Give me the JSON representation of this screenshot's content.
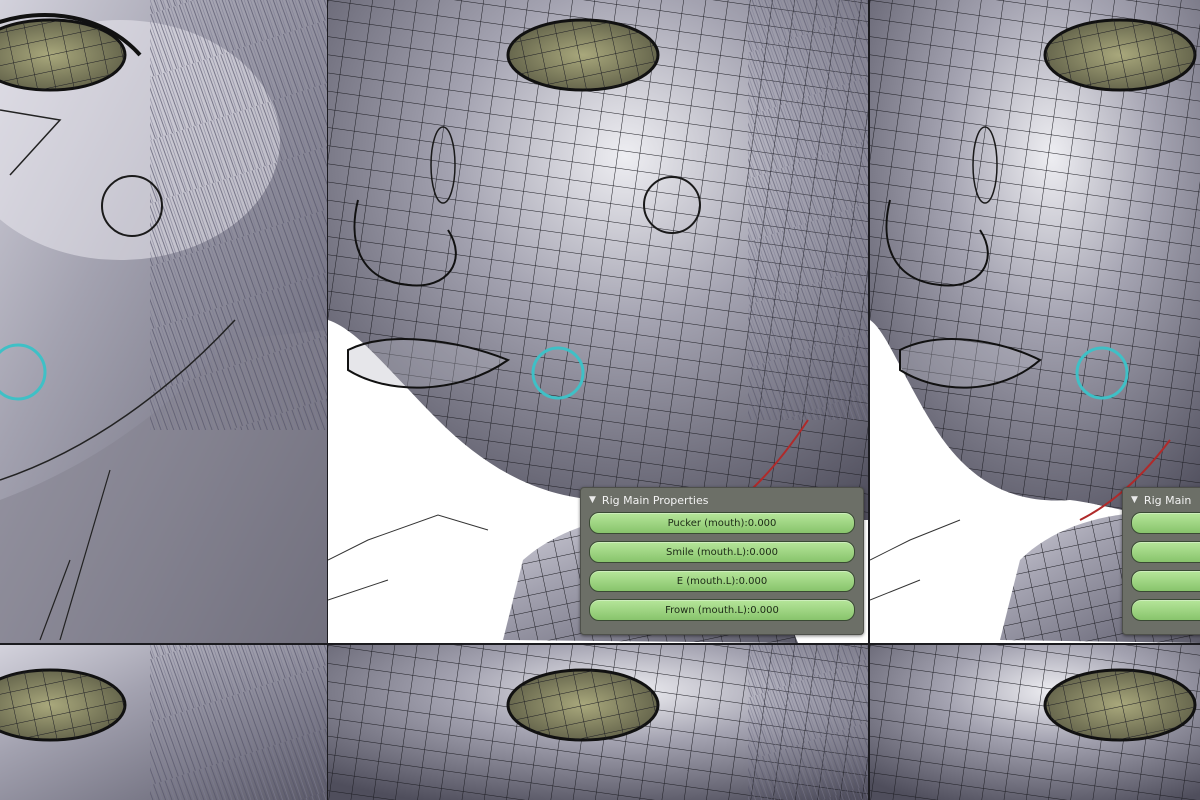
{
  "panel": {
    "title": "Rig Main Properties",
    "sliders": [
      {
        "name": "Pucker (mouth)",
        "value": "0.000"
      },
      {
        "name": "Smile (mouth.L)",
        "value": "0.000"
      },
      {
        "name": "E (mouth.L)",
        "value": "0.000"
      },
      {
        "name": "Frown (mouth.L)",
        "value": "0.000"
      }
    ]
  },
  "panel_clipped": {
    "title": "Rig Main"
  },
  "colors": {
    "mesh_shade": "#8e8d9a",
    "wire": "#1e1e24",
    "selection_ring": "#3fc0c6",
    "weight_curve": "#b02a2a",
    "slider_fill": "#9fd57f",
    "panel_bg": "#6c6f67"
  }
}
